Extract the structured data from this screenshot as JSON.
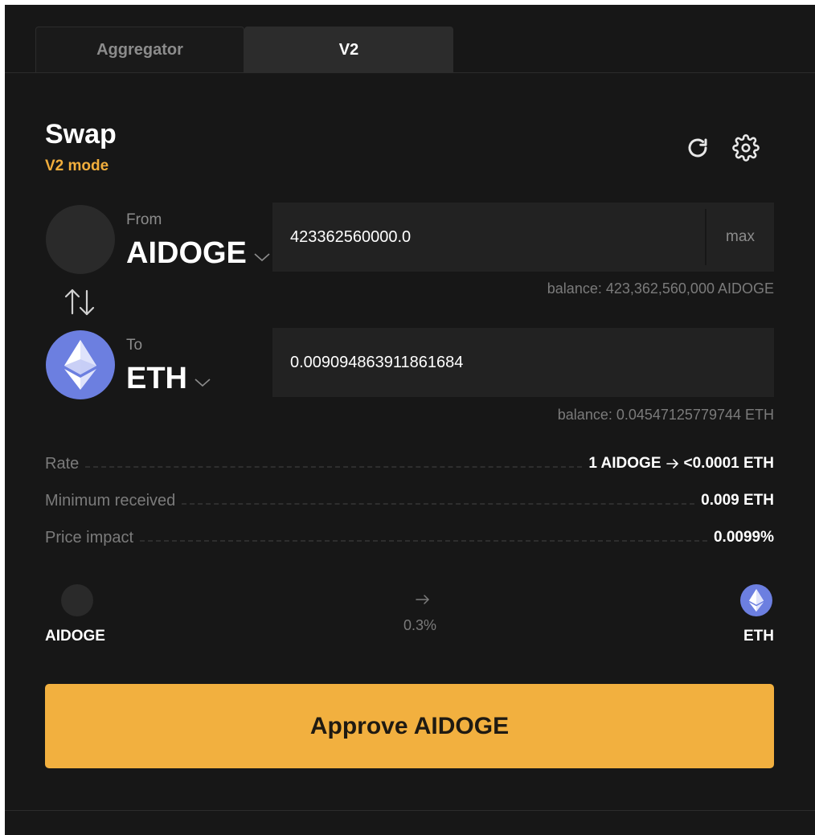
{
  "tabs": [
    {
      "label": "Aggregator",
      "active": false
    },
    {
      "label": "V2",
      "active": true
    }
  ],
  "header": {
    "title": "Swap",
    "mode": "V2 mode",
    "refresh_icon": "refresh-icon",
    "settings_icon": "gear-icon"
  },
  "from": {
    "label": "From",
    "token": "AIDOGE",
    "amount": "423362560000.0",
    "max_label": "max",
    "balance": "balance: 423,362,560,000 AIDOGE"
  },
  "to": {
    "label": "To",
    "token": "ETH",
    "amount": "0.009094863911861684",
    "balance": "balance: 0.04547125779744 ETH"
  },
  "details": {
    "rate_label": "Rate",
    "rate_from": "1 AIDOGE",
    "rate_to": "<0.0001 ETH",
    "min_label": "Minimum received",
    "min_value": "0.009 ETH",
    "impact_label": "Price impact",
    "impact_value": "0.0099%"
  },
  "route": {
    "from": "AIDOGE",
    "to": "ETH",
    "fee": "0.3%"
  },
  "action": {
    "label": "Approve AIDOGE"
  },
  "colors": {
    "background": "#171717",
    "accent": "#f2b03f",
    "mode": "#f2ae3c",
    "eth": "#6c7fe0"
  }
}
